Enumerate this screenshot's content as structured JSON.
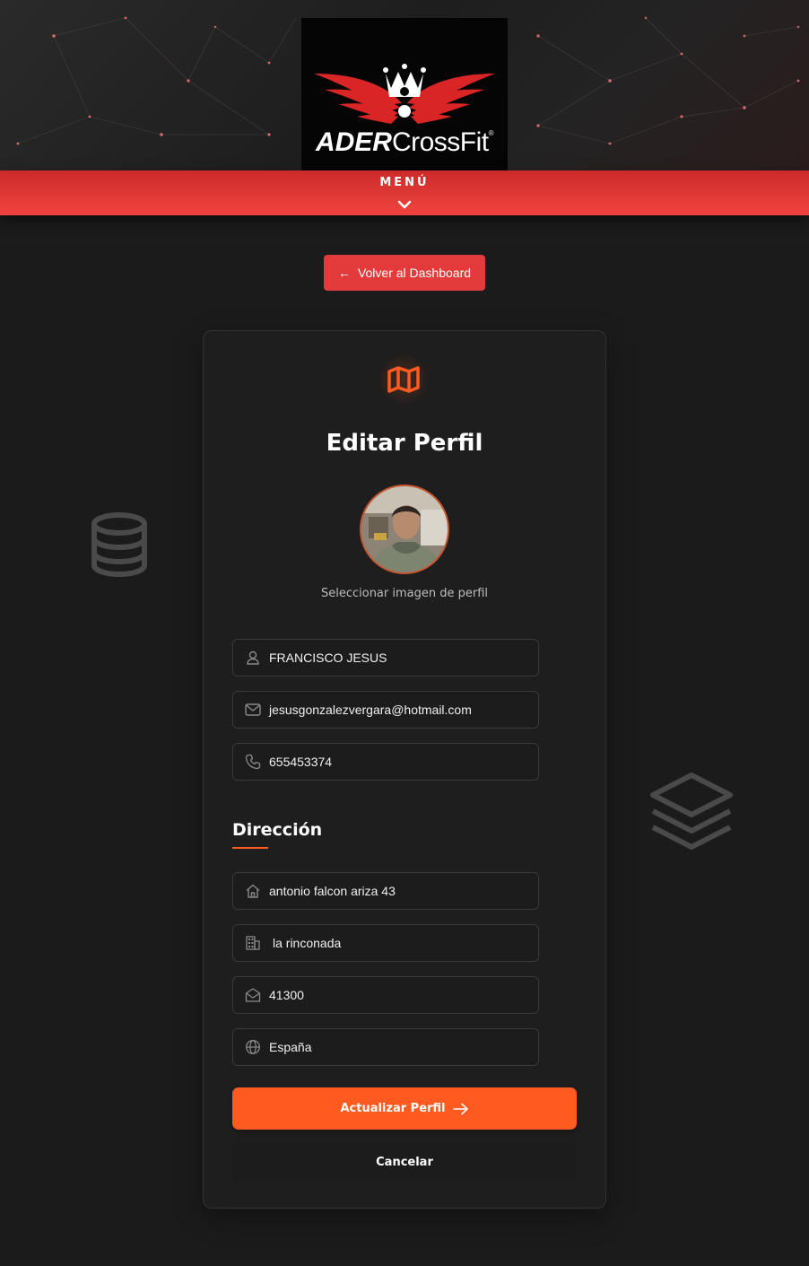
{
  "header": {
    "logo_brand": "ADER",
    "logo_suffix": "CrossFit",
    "logo_reg": "®",
    "menu_label": "MENÚ"
  },
  "nav": {
    "back_label": "Volver al Dashboard"
  },
  "profile": {
    "title": "Editar Perfil",
    "avatar_caption": "Seleccionar imagen de perfil",
    "name": "FRANCISCO JESUS",
    "email": "jesusgonzalezvergara@hotmail.com",
    "phone": "655453374"
  },
  "address": {
    "section_title": "Dirección",
    "street": "antonio falcon ariza 43",
    "city": "la rinconada",
    "postal_code": "41300",
    "country": "España"
  },
  "actions": {
    "submit_label": "Actualizar Perfil",
    "cancel_label": "Cancelar"
  },
  "icons": {
    "name": "user-icon",
    "email": "envelope-icon",
    "phone": "phone-icon",
    "street": "home-icon",
    "city": "building-icon",
    "postal_code": "mail-open-icon",
    "country": "globe-icon",
    "card": "map-icon",
    "deco_left": "database-icon",
    "deco_right": "layers-icon"
  },
  "colors": {
    "accent": "#ff5a1f",
    "menu_red": "#e23a37",
    "back_button": "#e33a3b",
    "background": "#1b1b1b"
  }
}
